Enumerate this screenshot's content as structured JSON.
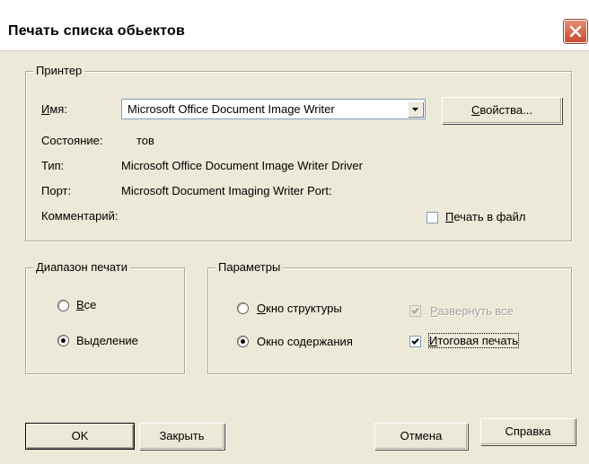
{
  "window": {
    "title": "Печать списка обьектов"
  },
  "printer": {
    "legend": "Принтер",
    "name_label": "Имя:",
    "name_value": "Microsoft Office Document Image Writer",
    "properties_button": "Свойства...",
    "state_label": "Состояние:",
    "state_value": "тов",
    "type_label": "Тип:",
    "type_value": "Microsoft Office Document Image Writer Driver",
    "port_label": "Порт:",
    "port_value": "Microsoft Document Imaging Writer Port:",
    "comment_label": "Комментарий:",
    "print_to_file_label": "Печать в файл",
    "print_to_file_checked": false
  },
  "range": {
    "legend": "Диапазон печати",
    "options": [
      {
        "label": "Все",
        "selected": false
      },
      {
        "label": "Выделение",
        "selected": true
      }
    ]
  },
  "params": {
    "legend": "Параметры",
    "structure_label": "Окно структуры",
    "structure_selected": false,
    "content_label": "Окно содержания",
    "content_selected": true,
    "expand_all_label": "Развернуть все",
    "expand_all_checked": true,
    "expand_all_enabled": false,
    "summary_print_label": "Итоговая печать",
    "summary_print_checked": true
  },
  "buttons": {
    "ok": "OK",
    "close": "Закрыть",
    "cancel": "Отмена",
    "help": "Справка"
  }
}
